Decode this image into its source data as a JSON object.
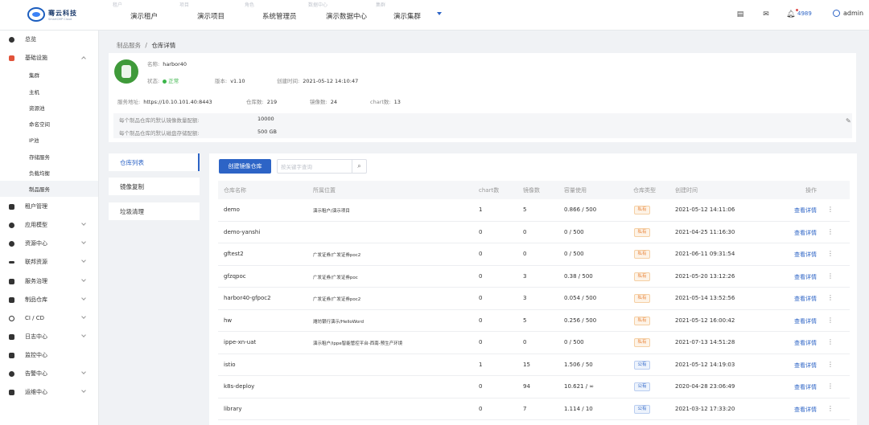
{
  "topbar": {
    "logo_name": "骞云科技",
    "logo_sub": "SmartCMP Cloud",
    "nav": [
      {
        "caption": "租户",
        "value": "演示租户"
      },
      {
        "caption": "项目",
        "value": "演示项目"
      },
      {
        "caption": "角色",
        "value": "系统管理员"
      },
      {
        "caption": "数据中心",
        "value": "演示数据中心"
      },
      {
        "caption": "集群",
        "value": "演示集群"
      }
    ],
    "notification_count": "4989",
    "username": "admin"
  },
  "sidebar": {
    "items": [
      {
        "label": "总览",
        "icon": "dashboard-icon"
      },
      {
        "label": "基础设施",
        "icon": "infrastructure-icon"
      },
      {
        "label": "租户管理",
        "icon": "tenant-icon"
      },
      {
        "label": "应用模型",
        "icon": "app-model-icon"
      },
      {
        "label": "资源中心",
        "icon": "resource-icon"
      },
      {
        "label": "联邦资源",
        "icon": "federation-icon"
      },
      {
        "label": "服务治理",
        "icon": "service-governance-icon"
      },
      {
        "label": "制品仓库",
        "icon": "artifact-icon"
      },
      {
        "label": "CI / CD",
        "icon": "cicd-icon"
      },
      {
        "label": "日志中心",
        "icon": "log-icon"
      },
      {
        "label": "监控中心",
        "icon": "monitor-icon"
      },
      {
        "label": "告警中心",
        "icon": "alert-icon"
      },
      {
        "label": "运维中心",
        "icon": "ops-icon"
      }
    ],
    "sub_items": [
      "集群",
      "主机",
      "资源池",
      "命名空间",
      "IP池",
      "存储服务",
      "负载均衡",
      "制品服务"
    ]
  },
  "breadcrumb": {
    "parent": "制品服务",
    "sep": "/",
    "current": "仓库详情"
  },
  "registry": {
    "name_label": "名称:",
    "name": "harbor40",
    "status_label": "状态:",
    "status": "正常",
    "version_label": "版本:",
    "version": "v1.10",
    "created_label": "创建时间:",
    "created": "2021-05-12 14:10:47",
    "address_label": "服务地址:",
    "address": "https://10.10.101.40:8443",
    "repo_count_label": "仓库数:",
    "repo_count": "219",
    "image_count_label": "镜像数:",
    "image_count": "24",
    "chart_count_label": "chart数:",
    "chart_count": "13",
    "quota_image_label": "每个制品仓库的默认镜像数量配额:",
    "quota_image": "10000",
    "quota_disk_label": "每个制品仓库的默认磁盘存储配额:",
    "quota_disk": "500 GB"
  },
  "left_menu": [
    "仓库列表",
    "镜像复制",
    "垃圾清理"
  ],
  "toolbar": {
    "create_label": "创建镜像仓库",
    "search_placeholder": "按关键字查询"
  },
  "table": {
    "headers": [
      "仓库名称",
      "所属位置",
      "chart数",
      "镜像数",
      "容量使用",
      "仓库类型",
      "创建时间",
      "操作"
    ],
    "rows": [
      {
        "name": "demo",
        "location": "演示租户/演示项目",
        "charts": "1",
        "images": "5",
        "usage": "0.866 / 500",
        "type": "私有",
        "created": "2021-05-12 14:11:06",
        "op": "查看详情"
      },
      {
        "name": "demo-yanshi",
        "location": "",
        "charts": "0",
        "images": "0",
        "usage": "0 / 500",
        "type": "私有",
        "created": "2021-04-25 11:16:30",
        "op": "查看详情"
      },
      {
        "name": "gftest2",
        "location": "广发证券/广发证券poc2",
        "charts": "0",
        "images": "0",
        "usage": "0 / 500",
        "type": "私有",
        "created": "2021-06-11 09:31:54",
        "op": "查看详情"
      },
      {
        "name": "gfzqpoc",
        "location": "广发证券/广发证券poc",
        "charts": "0",
        "images": "3",
        "usage": "0.38 / 500",
        "type": "私有",
        "created": "2021-05-20 13:12:26",
        "op": "查看详情"
      },
      {
        "name": "harbor40-gfpoc2",
        "location": "广发证券/广发证券poc2",
        "charts": "0",
        "images": "3",
        "usage": "0.054 / 500",
        "type": "私有",
        "created": "2021-05-14 13:52:56",
        "op": "查看详情"
      },
      {
        "name": "hw",
        "location": "潍坊银行演示/HelloWord",
        "charts": "0",
        "images": "5",
        "usage": "0.256 / 500",
        "type": "私有",
        "created": "2021-05-12 16:00:42",
        "op": "查看详情"
      },
      {
        "name": "ippe-xn-uat",
        "location": "演示租户/ippe智能管控平台-西南-预生产环境",
        "charts": "0",
        "images": "0",
        "usage": "0 / 500",
        "type": "私有",
        "created": "2021-07-13 14:51:28",
        "op": "查看详情"
      },
      {
        "name": "istio",
        "location": "",
        "charts": "1",
        "images": "15",
        "usage": "1.506 / 50",
        "type": "公有",
        "created": "2021-05-12 14:19:03",
        "op": "查看详情"
      },
      {
        "name": "k8s-deploy",
        "location": "",
        "charts": "0",
        "images": "94",
        "usage": "10.621 / ∞",
        "type": "公有",
        "created": "2020-04-28 23:06:49",
        "op": "查看详情"
      },
      {
        "name": "library",
        "location": "",
        "charts": "0",
        "images": "7",
        "usage": "1.114 / 10",
        "type": "公有",
        "created": "2021-03-12 17:33:20",
        "op": "查看详情"
      }
    ]
  }
}
